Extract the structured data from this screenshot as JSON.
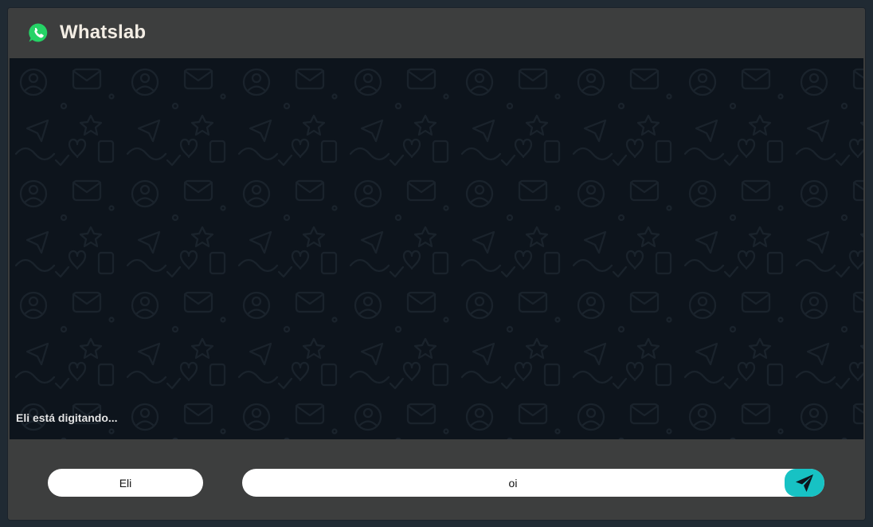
{
  "app": {
    "title": "Whatslab",
    "logo_icon": "whatsapp-icon"
  },
  "chat": {
    "typing_indicator": "Eli está digitando..."
  },
  "composer": {
    "name_value": "Eli",
    "message_value": "oi",
    "send_icon": "paper-plane-icon"
  },
  "colors": {
    "background": "#202a33",
    "panel": "#3d3e3e",
    "chat_background": "#0d141c",
    "send_button": "#17c2c4",
    "logo_green": "#25d366",
    "title_text": "#f3ede4"
  }
}
